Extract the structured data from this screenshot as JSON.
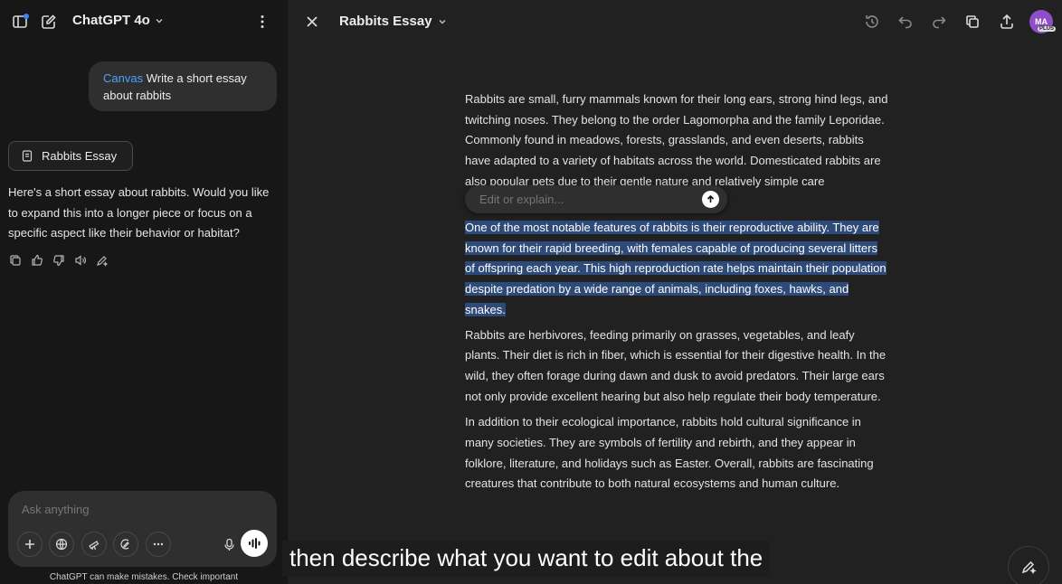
{
  "sidebar": {
    "model_title": "ChatGPT 4o",
    "user_message": {
      "tag": "Canvas",
      "text": "Write a short essay about rabbits"
    },
    "canvas_chip_label": "Rabbits Essay",
    "assistant_text": "Here's a short essay about rabbits. Would you like to expand this into a longer piece or focus on a specific aspect like their behavior or habitat?",
    "composer_placeholder": "Ask anything",
    "disclaimer": "ChatGPT can make mistakes. Check important"
  },
  "canvas": {
    "doc_title": "Rabbits Essay",
    "avatar_initials": "MA",
    "avatar_badge": "PLUS",
    "paragraphs": {
      "p1": "Rabbits are small, furry mammals known for their long ears, strong hind legs, and twitching noses. They belong to the order Lagomorpha and the family Leporidae. Commonly found in meadows, forests, grasslands, and even deserts, rabbits have adapted to a variety of habitats across the world. Domesticated rabbits are also popular pets due to their gentle nature and relatively simple care requirements.",
      "p2": "One of the most notable features of rabbits is their reproductive ability. They are known for their rapid breeding, with females capable of producing several litters of offspring each year. This high reproduction rate helps maintain their population despite predation by a wide range of animals, including foxes, hawks, and snakes.",
      "p3": "Rabbits are herbivores, feeding primarily on grasses, vegetables, and leafy plants. Their diet is rich in fiber, which is essential for their digestive health. In the wild, they often forage during dawn and dusk to avoid predators. Their large ears not only provide excellent hearing but also help regulate their body temperature.",
      "p4": "In addition to their ecological importance, rabbits hold cultural significance in many societies. They are symbols of fertility and rebirth, and they appear in folklore, literature, and holidays such as Easter. Overall, rabbits are fascinating creatures that contribute to both natural ecosystems and human culture."
    },
    "edit_placeholder": "Edit or explain...",
    "caption": "then describe what you want to edit about the"
  },
  "colors": {
    "sidebar_bg": "#171717",
    "canvas_bg": "#212121",
    "highlight": "#2e4a78",
    "accent": "#4aa3ff",
    "avatar": "#8e4ec6"
  }
}
